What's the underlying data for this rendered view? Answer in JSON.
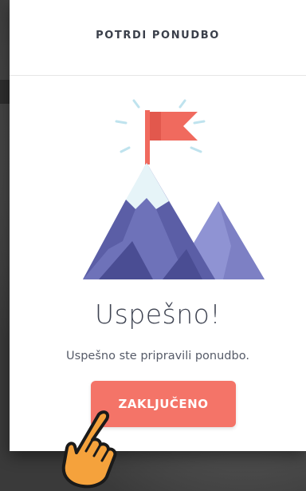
{
  "modal": {
    "title": "POTRDI PONUDBO",
    "success_title": "Uspešno!",
    "success_text": "Uspešno ste pripravili ponudbo.",
    "done_button_label": "ZAKLJUČENO"
  },
  "icons": {
    "illustration": "mountain-flag-icon",
    "cursor": "pointing-hand-icon"
  },
  "colors": {
    "accent": "#f47468",
    "flag": "#f06a5e",
    "mountain_dark": "#5b5ea6",
    "mountain_light": "#8f93d3",
    "snow": "#e6f4f8",
    "rays": "#bfe3ee",
    "hand": "#f5a23c"
  }
}
